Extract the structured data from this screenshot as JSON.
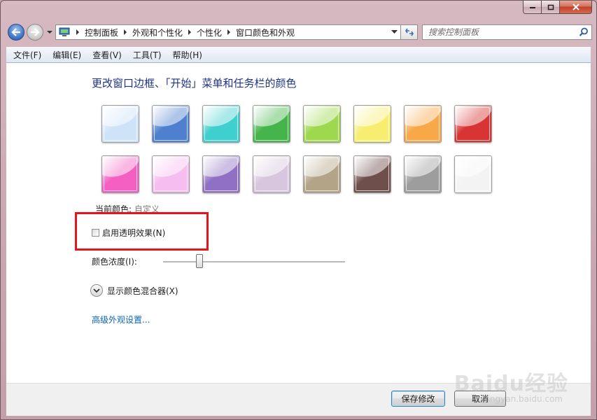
{
  "nav": {
    "breadcrumbs": [
      "控制面板",
      "外观和个性化",
      "个性化",
      "窗口颜色和外观"
    ],
    "search_placeholder": "搜索控制面板"
  },
  "menu": [
    "文件(F)",
    "编辑(E)",
    "查看(V)",
    "工具(T)",
    "帮助(H)"
  ],
  "content": {
    "heading": "更改窗口边框、「开始」菜单和任务栏的颜色",
    "swatches_row1": [
      "#cfe3f8",
      "#4f7fcf",
      "#3fcfcf",
      "#44b54a",
      "#9ed84f",
      "#f7ee6f",
      "#f8a848",
      "#d93434"
    ],
    "swatches_row2": [
      "#f45fc1",
      "#f6bdf0",
      "#8f70c4",
      "#d7c6de",
      "#b3a488",
      "#6f4f4c",
      "#9d9d9d",
      "#f3f3f3"
    ],
    "current_color_label": "当前颜色:",
    "current_color_value": "自定义",
    "transparency_label": "启用透明效果(N)",
    "transparency_checked": false,
    "intensity_label": "颜色浓度(I):",
    "intensity_value": 0.2,
    "mixer_label": "显示颜色混合器(X)",
    "advanced_link": "高级外观设置..."
  },
  "buttons": {
    "save": "保存修改",
    "cancel": "取消"
  },
  "watermark": {
    "main": "Baidu经验",
    "sub": "jingyan.baidu.com"
  },
  "highlight_color": "#e8141b"
}
